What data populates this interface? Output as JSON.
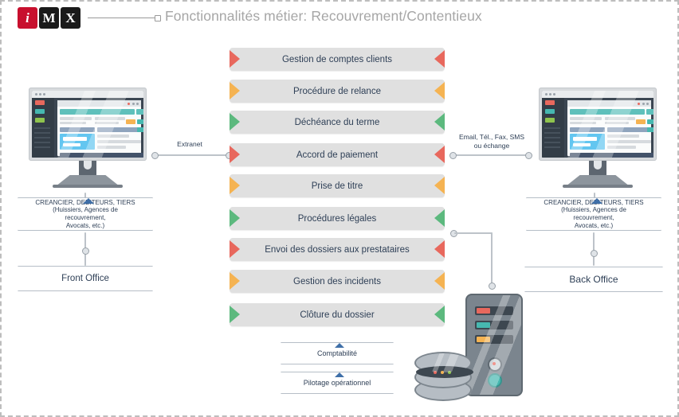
{
  "header": {
    "logo": [
      {
        "letter": "i",
        "bg": "#c8102e"
      },
      {
        "letter": "M",
        "bg": "#1a1a1a"
      },
      {
        "letter": "X",
        "bg": "#1a1a1a"
      }
    ],
    "title": "Fonctionnalités métier: Recouvrement/Contentieux",
    "title_color": "#a6a6a6"
  },
  "palette": {
    "red": "#e8685d",
    "orange": "#f5b352",
    "green": "#5cb97e",
    "bar_bg": "#e0e0e0",
    "text": "#2f4057",
    "connector": "#bdc3c9",
    "ribbon_border": "#b6bec7",
    "slide_border": "#bdbdbd"
  },
  "process_bars": [
    {
      "label": "Gestion de comptes clients",
      "color": "#e8685d"
    },
    {
      "label": "Procédure de relance",
      "color": "#f5b352"
    },
    {
      "label": "Déchéance du terme",
      "color": "#5cb97e"
    },
    {
      "label": "Accord de paiement",
      "color": "#e8685d"
    },
    {
      "label": "Prise de titre",
      "color": "#f5b352"
    },
    {
      "label": "Procédures légales",
      "color": "#5cb97e"
    },
    {
      "label": "Envoi des dossiers aux prestataires",
      "color": "#e8685d"
    },
    {
      "label": "Gestion des incidents",
      "color": "#f5b352"
    },
    {
      "label": "Clôture du dossier",
      "color": "#5cb97e"
    }
  ],
  "bottom_boxes": [
    {
      "label": "Comptabilité"
    },
    {
      "label": "Pilotage opérationnel"
    }
  ],
  "left_side": {
    "actor_line1": "CREANCIER, DEBITEURS, TIERS",
    "actor_line2": "(Huissiers, Agences de recouvrement,",
    "actor_line3": "Avocats, etc.)",
    "office": "Front Office"
  },
  "right_side": {
    "actor_line1": "CREANCIER, DEBITEURS, TIERS",
    "actor_line2": "(Huissiers, Agences de recouvrement,",
    "actor_line3": "Avocats, etc.)",
    "office": "Back Office"
  },
  "connectors": {
    "left_label": "Extranet",
    "right_label_line1": "Email, Tél., Fax, SMS",
    "right_label_line2": "ou échange"
  },
  "infrastructure": {
    "server_name": "server-tower-icon",
    "database_name": "database-stack-icon",
    "server_slot_colors": [
      "#e8685d",
      "#46b8b0",
      "#f5b352"
    ],
    "server_button_colors": [
      "#e8685d",
      "#46b8b0"
    ]
  },
  "monitors": {
    "left_name": "front-office-monitor-icon",
    "right_name": "back-office-monitor-icon"
  }
}
